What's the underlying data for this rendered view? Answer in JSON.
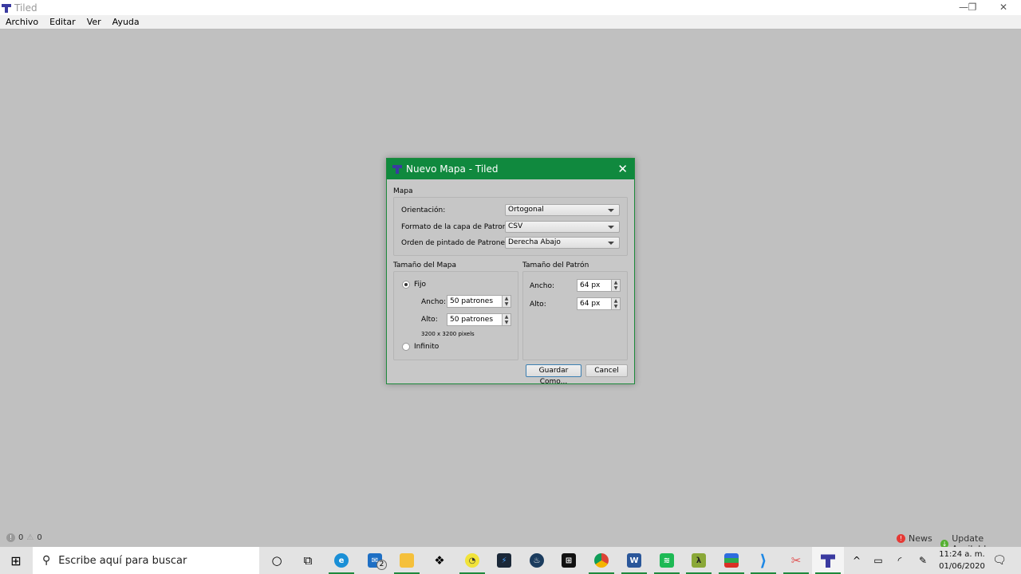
{
  "app": {
    "title": "Tiled",
    "menu": [
      "Archivo",
      "Editar",
      "Ver",
      "Ayuda"
    ]
  },
  "dialog": {
    "title": "Nuevo Mapa - Tiled",
    "map_group": "Mapa",
    "orientation_label": "Orientación:",
    "orientation": "Ortogonal",
    "layer_format_label": "Formato de la capa de Patrones:",
    "layer_format": "CSV",
    "render_order_label": "Orden de pintado de Patrones:",
    "render_order": "Derecha Abajo",
    "map_size_group": "Tamaño del Mapa",
    "fixed_label": "Fijo",
    "width_label": "Ancho:",
    "width": "50 patrones",
    "height_label": "Alto:",
    "height": "50 patrones",
    "pixel_size": "3200 x 3200 pixels",
    "infinite_label": "Infinito",
    "tile_size_group": "Tamaño del Patrón",
    "tile_width_label": "Ancho:",
    "tile_width": "64 px",
    "tile_height_label": "Alto:",
    "tile_height": "64 px",
    "save_as": "Guardar Como...",
    "cancel": "Cancel"
  },
  "status": {
    "errors": "0",
    "warnings": "0",
    "news": "News",
    "update": "Update Available"
  },
  "taskbar": {
    "search_placeholder": "Escribe aquí para buscar",
    "mail_badge": "2",
    "time": "11:24 a. m.",
    "date": "01/06/2020"
  }
}
